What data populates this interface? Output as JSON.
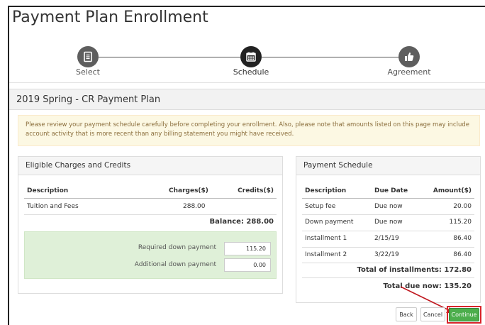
{
  "page": {
    "title": "Payment Plan Enrollment"
  },
  "steps": [
    {
      "label": "Select",
      "icon": "document-icon",
      "active": false
    },
    {
      "label": "Schedule",
      "icon": "calendar-icon",
      "active": true
    },
    {
      "label": "Agreement",
      "icon": "thumbs-up-icon",
      "active": false
    }
  ],
  "plan": {
    "title": "2019 Spring - CR Payment Plan"
  },
  "alert": {
    "text": "Please review your payment schedule carefully before completing your enrollment. Also, please note that amounts listed on this page may include account activity that is more recent than any billing statement you might have received."
  },
  "charges": {
    "heading": "Eligible Charges and Credits",
    "columns": [
      "Description",
      "Charges($)",
      "Credits($)"
    ],
    "rows": [
      {
        "description": "Tuition and Fees",
        "charges": "288.00",
        "credits": ""
      }
    ],
    "balance": "Balance: 288.00",
    "required_label": "Required down payment",
    "required_value": "115.20",
    "additional_label": "Additional down payment",
    "additional_value": "0.00"
  },
  "schedule": {
    "heading": "Payment Schedule",
    "columns": [
      "Description",
      "Due Date",
      "Amount($)"
    ],
    "rows": [
      {
        "description": "Setup fee",
        "due": "Due now",
        "amount": "20.00"
      },
      {
        "description": "Down payment",
        "due": "Due now",
        "amount": "115.20"
      },
      {
        "description": "Installment 1",
        "due": "2/15/19",
        "amount": "86.40"
      },
      {
        "description": "Installment 2",
        "due": "3/22/19",
        "amount": "86.40"
      }
    ],
    "total_installments": "Total of installments: 172.80",
    "total_due_now": "Total due now: 135.20"
  },
  "buttons": {
    "back": "Back",
    "cancel": "Cancel",
    "continue": "Continue"
  },
  "colors": {
    "continue_green": "#4cae4c",
    "highlight_red": "#d9242b",
    "alert_bg": "#fcf8e3",
    "green_box": "#dff0d8"
  }
}
